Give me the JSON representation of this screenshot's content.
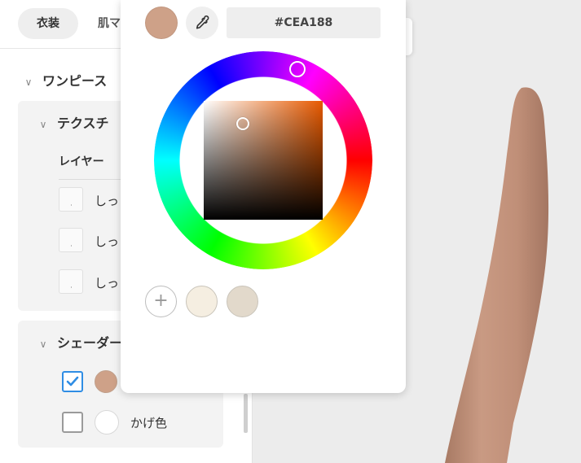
{
  "tabs": [
    "衣装",
    "肌マ"
  ],
  "sections": {
    "onepiece": "ワンピース",
    "texture": "テクスチ",
    "layer_header": "レイヤー",
    "shader": "シェーダー"
  },
  "layers": [
    "しっ",
    "しっ",
    "しっ"
  ],
  "shader_rows": [
    {
      "checked": true,
      "color": "#CEA188",
      "label": ""
    },
    {
      "checked": false,
      "color": "#FFFFFF",
      "label": "かげ色"
    }
  ],
  "picker": {
    "current_color": "#CEA188",
    "hex_value": "#CEA188",
    "add_symbol": "+",
    "saved_swatches": [
      "#F5EEE1",
      "#E2D9CB"
    ]
  },
  "icons": {
    "eyedropper": "eyedropper-icon",
    "chevron": "chevron-down-icon",
    "check": "check-icon"
  },
  "colors": {
    "accent": "#2F8DE4",
    "skin": "#C49480"
  }
}
